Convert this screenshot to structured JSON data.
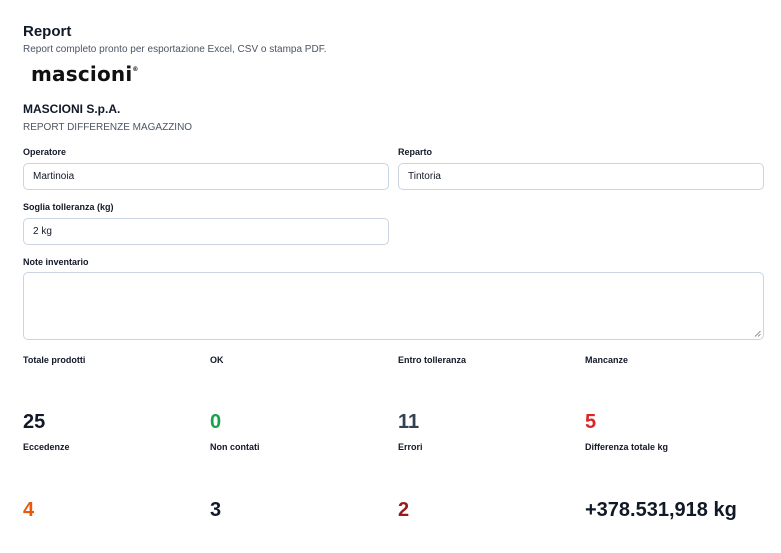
{
  "header": {
    "title": "Report",
    "subtitle": "Report completo pronto per esportazione Excel, CSV o stampa PDF."
  },
  "logo": {
    "text": "mascioni",
    "mark": "®"
  },
  "company": {
    "name": "MASCIONI S.p.A.",
    "report_type": "REPORT DIFFERENZE MAGAZZINO"
  },
  "form": {
    "operatore": {
      "label": "Operatore",
      "value": "Martinoia"
    },
    "reparto": {
      "label": "Reparto",
      "value": "Tintoria"
    },
    "soglia": {
      "label": "Soglia tolleranza (kg)",
      "value": "2 kg"
    },
    "note": {
      "label": "Note inventario",
      "value": ""
    }
  },
  "stats": [
    {
      "label": "Totale prodotti",
      "value": "25",
      "color": "#111827"
    },
    {
      "label": "OK",
      "value": "0",
      "color": "#16a34a"
    },
    {
      "label": "Entro tolleranza",
      "value": "11",
      "color": "#334155"
    },
    {
      "label": "Mancanze",
      "value": "5",
      "color": "#dc2626"
    },
    {
      "label": "Eccedenze",
      "value": "4",
      "color": "#ea580c"
    },
    {
      "label": "Non contati",
      "value": "3",
      "color": "#111827"
    },
    {
      "label": "Errori",
      "value": "2",
      "color": "#991b1b"
    },
    {
      "label": "Differenza totale kg",
      "value": "+378.531,918 kg",
      "color": "#111827"
    }
  ]
}
